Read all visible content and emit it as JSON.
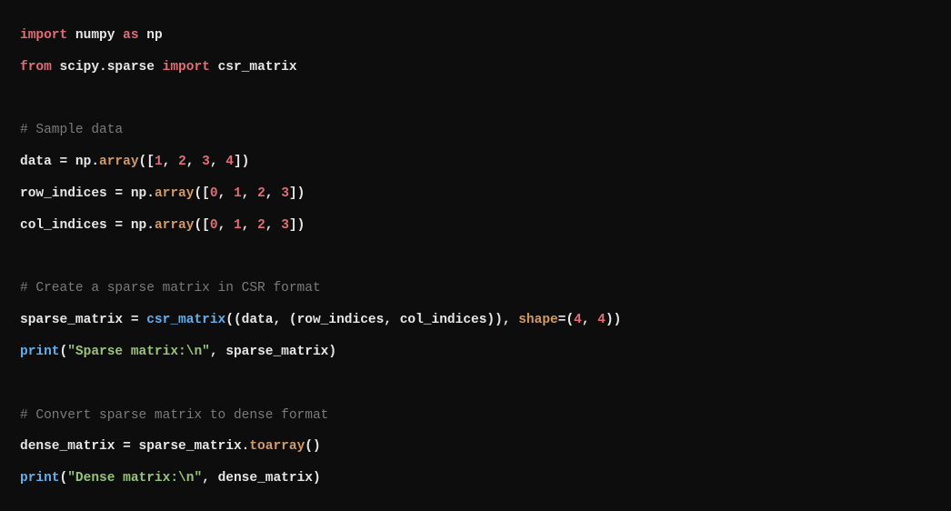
{
  "code": {
    "line1": {
      "kw_import": "import",
      "mod_numpy": "numpy",
      "kw_as": "as",
      "alias_np": "np"
    },
    "line2": {
      "kw_from": "from",
      "mod_scipy": "scipy.sparse",
      "kw_import": "import",
      "name_csr": "csr_matrix"
    },
    "comment1": "# Sample data",
    "line4": {
      "var": "data",
      "eq": " = ",
      "np": "np.",
      "array": "array",
      "open": "([",
      "n1": "1",
      "c1": ", ",
      "n2": "2",
      "c2": ", ",
      "n3": "3",
      "c3": ", ",
      "n4": "4",
      "close": "])"
    },
    "line5": {
      "var": "row_indices",
      "eq": " = ",
      "np": "np.",
      "array": "array",
      "open": "([",
      "n1": "0",
      "c1": ", ",
      "n2": "1",
      "c2": ", ",
      "n3": "2",
      "c3": ", ",
      "n4": "3",
      "close": "])"
    },
    "line6": {
      "var": "col_indices",
      "eq": " = ",
      "np": "np.",
      "array": "array",
      "open": "([",
      "n1": "0",
      "c1": ", ",
      "n2": "1",
      "c2": ", ",
      "n3": "2",
      "c3": ", ",
      "n4": "3",
      "close": "])"
    },
    "comment2": "# Create a sparse matrix in CSR format",
    "line8": {
      "var": "sparse_matrix",
      "eq": " = ",
      "func": "csr_matrix",
      "open1": "((",
      "arg1": "data",
      "c1": ", (",
      "arg2": "row_indices",
      "c2": ", ",
      "arg3": "col_indices",
      "close1": ")), ",
      "shape_kw": "shape",
      "eq2": "=(",
      "n1": "4",
      "c3": ", ",
      "n2": "4",
      "close2": "))"
    },
    "line9": {
      "print": "print",
      "open": "(",
      "str": "\"Sparse matrix:\\n\"",
      "c1": ", ",
      "arg": "sparse_matrix",
      "close": ")"
    },
    "comment3": "# Convert sparse matrix to dense format",
    "line11": {
      "var": "dense_matrix",
      "eq": " = ",
      "obj": "sparse_matrix.",
      "method": "toarray",
      "parens": "()"
    },
    "line12": {
      "print": "print",
      "open": "(",
      "str": "\"Dense matrix:\\n\"",
      "c1": ", ",
      "arg": "dense_matrix",
      "close": ")"
    }
  }
}
